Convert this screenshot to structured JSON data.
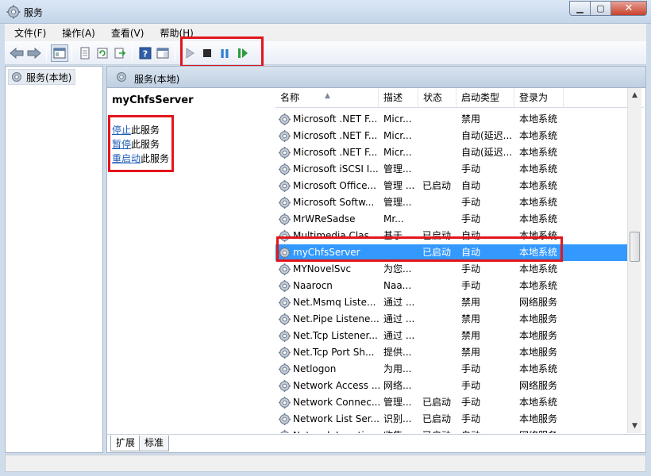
{
  "window": {
    "title": "服务",
    "min_glyph": "▁",
    "max_glyph": "▢",
    "close_glyph": "✕"
  },
  "menu": [
    "文件(F)",
    "操作(A)",
    "查看(V)",
    "帮助(H)"
  ],
  "tree": {
    "root_label": "服务(本地)"
  },
  "pane": {
    "header_title": "服务(本地)",
    "selected_service": "myChfsServer",
    "actions": [
      {
        "link": "停止",
        "suffix": "此服务"
      },
      {
        "link": "暂停",
        "suffix": "此服务"
      },
      {
        "link": "重启动",
        "suffix": "此服务"
      }
    ]
  },
  "list": {
    "columns": [
      "名称",
      "描述",
      "状态",
      "启动类型",
      "登录为"
    ],
    "sort_glyph": "▲",
    "rows": [
      {
        "name": "Microsoft .NET F...",
        "desc": "Micr...",
        "status": "",
        "startup": "禁用",
        "logon": "本地系统"
      },
      {
        "name": "Microsoft .NET F...",
        "desc": "Micr...",
        "status": "",
        "startup": "自动(延迟...",
        "logon": "本地系统"
      },
      {
        "name": "Microsoft .NET F...",
        "desc": "Micr...",
        "status": "",
        "startup": "自动(延迟...",
        "logon": "本地系统"
      },
      {
        "name": "Microsoft iSCSI I...",
        "desc": "管理...",
        "status": "",
        "startup": "手动",
        "logon": "本地系统"
      },
      {
        "name": "Microsoft Office...",
        "desc": "管理 ...",
        "status": "已启动",
        "startup": "自动",
        "logon": "本地系统"
      },
      {
        "name": "Microsoft Softw...",
        "desc": "管理...",
        "status": "",
        "startup": "手动",
        "logon": "本地系统"
      },
      {
        "name": "MrWReSadse",
        "desc": "Mr...",
        "status": "",
        "startup": "手动",
        "logon": "本地系统"
      },
      {
        "name": "Multimedia Clas...",
        "desc": "基于...",
        "status": "已启动",
        "startup": "自动",
        "logon": "本地系统"
      },
      {
        "name": "myChfsServer",
        "desc": "",
        "status": "已启动",
        "startup": "自动",
        "logon": "本地系统"
      },
      {
        "name": "MYNovelSvc",
        "desc": "为您...",
        "status": "",
        "startup": "手动",
        "logon": "本地系统"
      },
      {
        "name": "Naarocn",
        "desc": "Naa...",
        "status": "",
        "startup": "手动",
        "logon": "本地系统"
      },
      {
        "name": "Net.Msmq Liste...",
        "desc": "通过 ...",
        "status": "",
        "startup": "禁用",
        "logon": "网络服务"
      },
      {
        "name": "Net.Pipe Listene...",
        "desc": "通过 ...",
        "status": "",
        "startup": "禁用",
        "logon": "本地服务"
      },
      {
        "name": "Net.Tcp Listener...",
        "desc": "通过 ...",
        "status": "",
        "startup": "禁用",
        "logon": "本地服务"
      },
      {
        "name": "Net.Tcp Port Sh...",
        "desc": "提供...",
        "status": "",
        "startup": "禁用",
        "logon": "本地服务"
      },
      {
        "name": "Netlogon",
        "desc": "为用...",
        "status": "",
        "startup": "手动",
        "logon": "本地系统"
      },
      {
        "name": "Network Access ...",
        "desc": "网络...",
        "status": "",
        "startup": "手动",
        "logon": "网络服务"
      },
      {
        "name": "Network Connec...",
        "desc": "管理...",
        "status": "已启动",
        "startup": "手动",
        "logon": "本地系统"
      },
      {
        "name": "Network List Ser...",
        "desc": "识别...",
        "status": "已启动",
        "startup": "手动",
        "logon": "本地服务"
      },
      {
        "name": "Network Locatio...",
        "desc": "收集...",
        "status": "已启动",
        "startup": "自动",
        "logon": "网络服务"
      }
    ],
    "selected_index": 8
  },
  "scroll": {
    "up_glyph": "▲",
    "down_glyph": "▼"
  },
  "tabs": [
    "扩展",
    "标准"
  ],
  "icons": {
    "back": "back-arrow-icon",
    "forward": "forward-arrow-icon",
    "start": "play-icon",
    "stop": "stop-icon",
    "pause": "pause-icon",
    "resume": "resume-icon",
    "service": "gear-icon"
  },
  "colors": {
    "highlight": "#e2161d",
    "selection": "#3399ff",
    "link": "#1d5bb8"
  }
}
